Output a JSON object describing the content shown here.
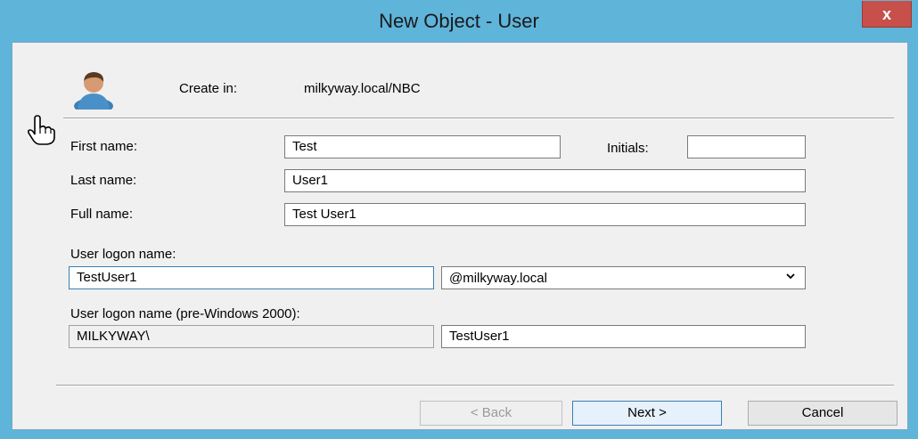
{
  "window": {
    "title": "New Object - User",
    "close_glyph": "x"
  },
  "header": {
    "create_in_label": "Create in:",
    "create_in_value": "milkyway.local/NBC"
  },
  "form": {
    "first_name_label": "First name:",
    "first_name_value": "Test",
    "initials_label": "Initials:",
    "initials_value": "",
    "last_name_label": "Last name:",
    "last_name_value": "User1",
    "full_name_label": "Full name:",
    "full_name_value": "Test User1",
    "logon_name_label": "User logon name:",
    "logon_name_value": "TestUser1",
    "domain_suffix_value": "@milkyway.local",
    "pre2000_label": "User logon name (pre-Windows 2000):",
    "pre2000_domain_value": "MILKYWAY\\",
    "pre2000_name_value": "TestUser1"
  },
  "buttons": {
    "back": "< Back",
    "next": "Next >",
    "cancel": "Cancel"
  },
  "icons": {
    "user": "user-icon",
    "cursor": "hand-pointer-icon",
    "dropdown": "chevron-down-icon",
    "close": "close-icon"
  }
}
